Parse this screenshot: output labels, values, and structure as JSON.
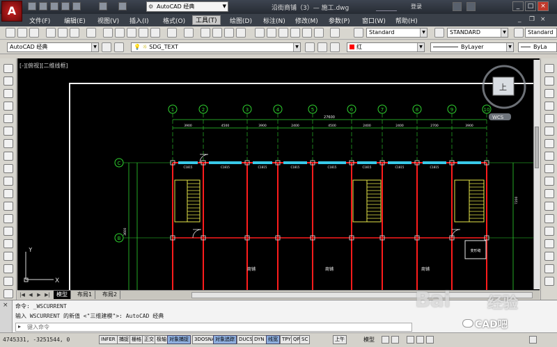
{
  "titlebar": {
    "app_logo": "A",
    "workspace": "AutoCAD 经典",
    "window_title": "沿街商铺（3）— 施工.dwg",
    "login": "登录"
  },
  "menubar": {
    "items": [
      "文件(F)",
      "编辑(E)",
      "视图(V)",
      "插入(I)",
      "格式(O)",
      "工具(T)",
      "绘图(D)",
      "标注(N)",
      "修改(M)",
      "参数(P)",
      "窗口(W)",
      "帮助(H)"
    ],
    "active_index": 5
  },
  "toolbar1": {
    "text_style": "Standard",
    "dim_style": "STANDARD",
    "table_style": "Standard"
  },
  "toolbar2": {
    "workspace": "AutoCAD 经典",
    "layer": "SDG_TEXT",
    "color": "红",
    "color_hex": "#ff0000",
    "linetype": "ByLayer",
    "lineweight": "ByLa"
  },
  "viewport": {
    "label": "[-][俯视][二维线框]",
    "ucs_x": "X",
    "ucs_y": "Y",
    "viewcube_face": "上",
    "wcs_label": "WCS"
  },
  "drawing": {
    "grid_axis_labels": [
      "1",
      "2",
      "3",
      "4",
      "5",
      "6",
      "7",
      "8",
      "9",
      "10"
    ],
    "row_axis_labels": [
      "C",
      "B"
    ],
    "overall_dimension": "27600",
    "bay_dimensions": [
      "3900",
      "4500",
      "3900",
      "2400",
      "4500",
      "2400",
      "2400",
      "2700",
      "3900"
    ],
    "left_dimension": "3600",
    "right_dimension": "7200",
    "window_labels": [
      "C1815",
      "C1815",
      "C1815",
      "C1815",
      "C1815",
      "C1815",
      "C1815",
      "C1815"
    ],
    "room_labels": [
      "商铺",
      "商铺",
      "商铺"
    ],
    "detail_label": "变形缝"
  },
  "layout_tabs": [
    "模型",
    "布局1",
    "布局2"
  ],
  "command": {
    "history": [
      "命令: _WSCURRENT",
      "输入 WSCURRENT 的新值 <\"三维建模\">: AutoCAD 经典"
    ],
    "placeholder": "键入命令"
  },
  "statusbar": {
    "coords": "4745331, -3251544, 0",
    "toggles": [
      "INFER",
      "捕捉",
      "栅格",
      "正交",
      "极轴",
      "对象捕捉",
      "3DOSNAP",
      "对象追踪",
      "DUCS",
      "DYN",
      "线宽",
      "TPY",
      "QP",
      "SC",
      "上午"
    ],
    "toggles_on": [
      5,
      7,
      10
    ],
    "model": "模型"
  },
  "watermark": {
    "text": "Bai",
    "sub": "经验",
    "badge": "CAD吧"
  }
}
